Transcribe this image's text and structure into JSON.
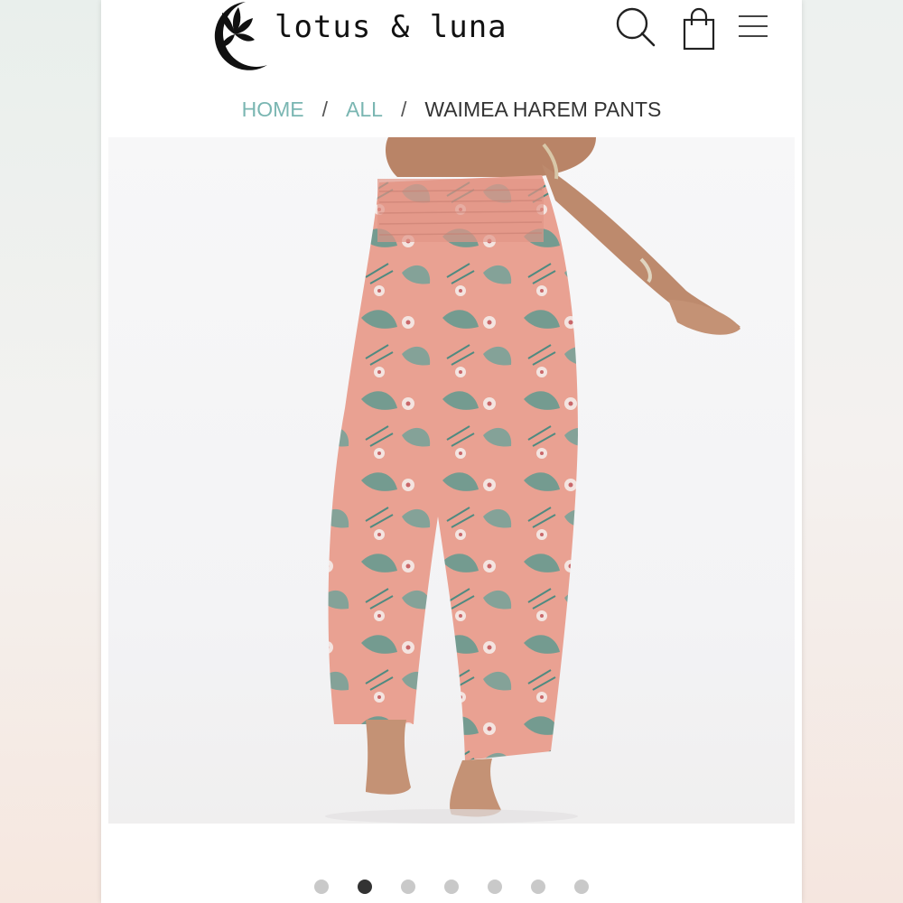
{
  "header": {
    "brand_name": "lotus & luna",
    "icons": {
      "logo": "lotus-moon-logo",
      "search": "search-icon",
      "bag": "shopping-bag-icon",
      "menu": "hamburger-menu-icon"
    }
  },
  "breadcrumb": {
    "home": "HOME",
    "separator": "/",
    "all": "ALL",
    "current": "WAIMEA HAREM PANTS"
  },
  "product": {
    "carousel_total": 7,
    "carousel_active_index": 1
  },
  "colors": {
    "breadcrumb_link": "#7ab6b2",
    "text_dark": "#333333",
    "pants_base": "#e9a192",
    "leaf_teal": "#5f9a90",
    "dot_active": "#333333",
    "dot_inactive": "#c9c9c9"
  }
}
